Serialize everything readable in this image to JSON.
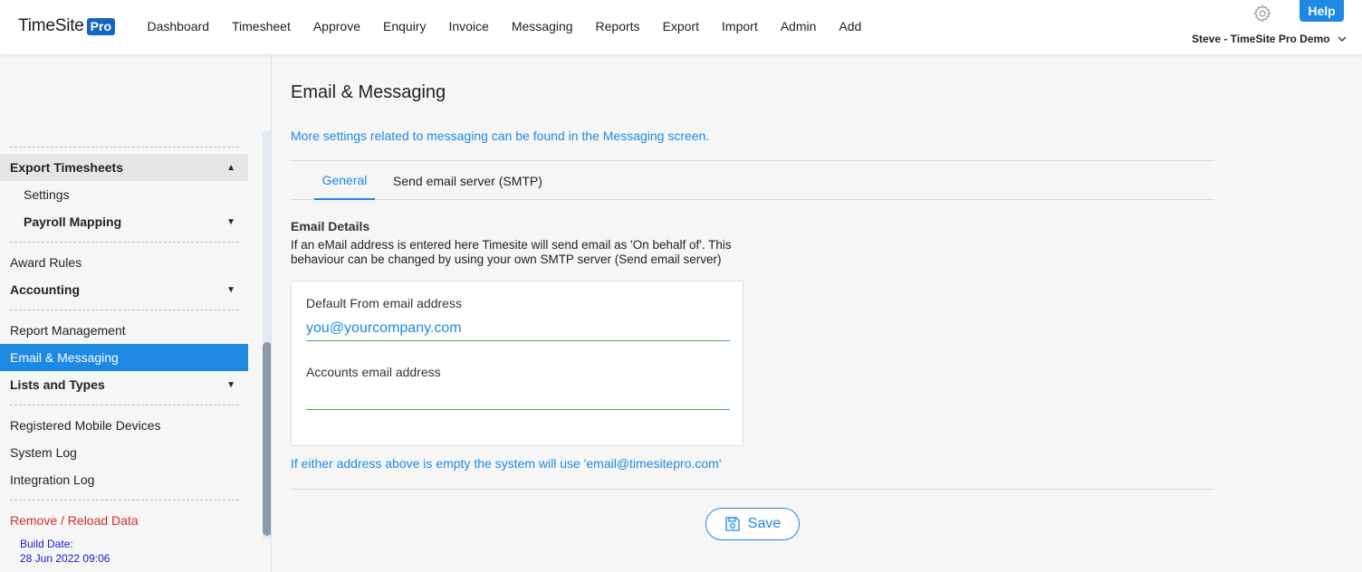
{
  "header": {
    "logo_text": "TimeSite",
    "logo_badge": "Pro",
    "nav": [
      "Dashboard",
      "Timesheet",
      "Approve",
      "Enquiry",
      "Invoice",
      "Messaging",
      "Reports",
      "Export",
      "Import",
      "Admin",
      "Add"
    ],
    "help_label": "Help",
    "user_label": "Steve - TimeSite Pro Demo",
    "icons": {
      "settings": "gear-icon",
      "user_menu": "chevron-down-icon"
    }
  },
  "sidebar": {
    "export_timesheets": "Export Timesheets",
    "settings": "Settings",
    "payroll_mapping": "Payroll Mapping",
    "award_rules": "Award Rules",
    "accounting": "Accounting",
    "report_management": "Report Management",
    "email_messaging": "Email & Messaging",
    "lists_types": "Lists and Types",
    "registered_devices": "Registered Mobile Devices",
    "system_log": "System Log",
    "integration_log": "Integration Log",
    "remove_reload": "Remove / Reload Data",
    "build_label": "Build Date:",
    "build_date": "28 Jun 2022 09:06"
  },
  "main": {
    "title": "Email & Messaging",
    "info": "More settings related to messaging can be found in the Messaging screen.",
    "tabs": [
      {
        "label": "General",
        "active": true
      },
      {
        "label": "Send email server (SMTP)",
        "active": false
      }
    ],
    "section_title": "Email Details",
    "section_desc": "If an eMail address is entered here Timesite will send email as 'On behalf of'. This behaviour can be changed by using your own SMTP server (Send email server)",
    "default_from_label": "Default From email address",
    "default_from_value": "you@yourcompany.com",
    "accounts_label": "Accounts email address",
    "accounts_value": "",
    "hint": "If either address above is empty the system will use 'email@timesitepro.com'",
    "save_label": "Save"
  },
  "colors": {
    "accent": "#1e88e5",
    "brand": "#1565c0",
    "input_underline": "#4caf50",
    "danger": "#d32f2f"
  }
}
